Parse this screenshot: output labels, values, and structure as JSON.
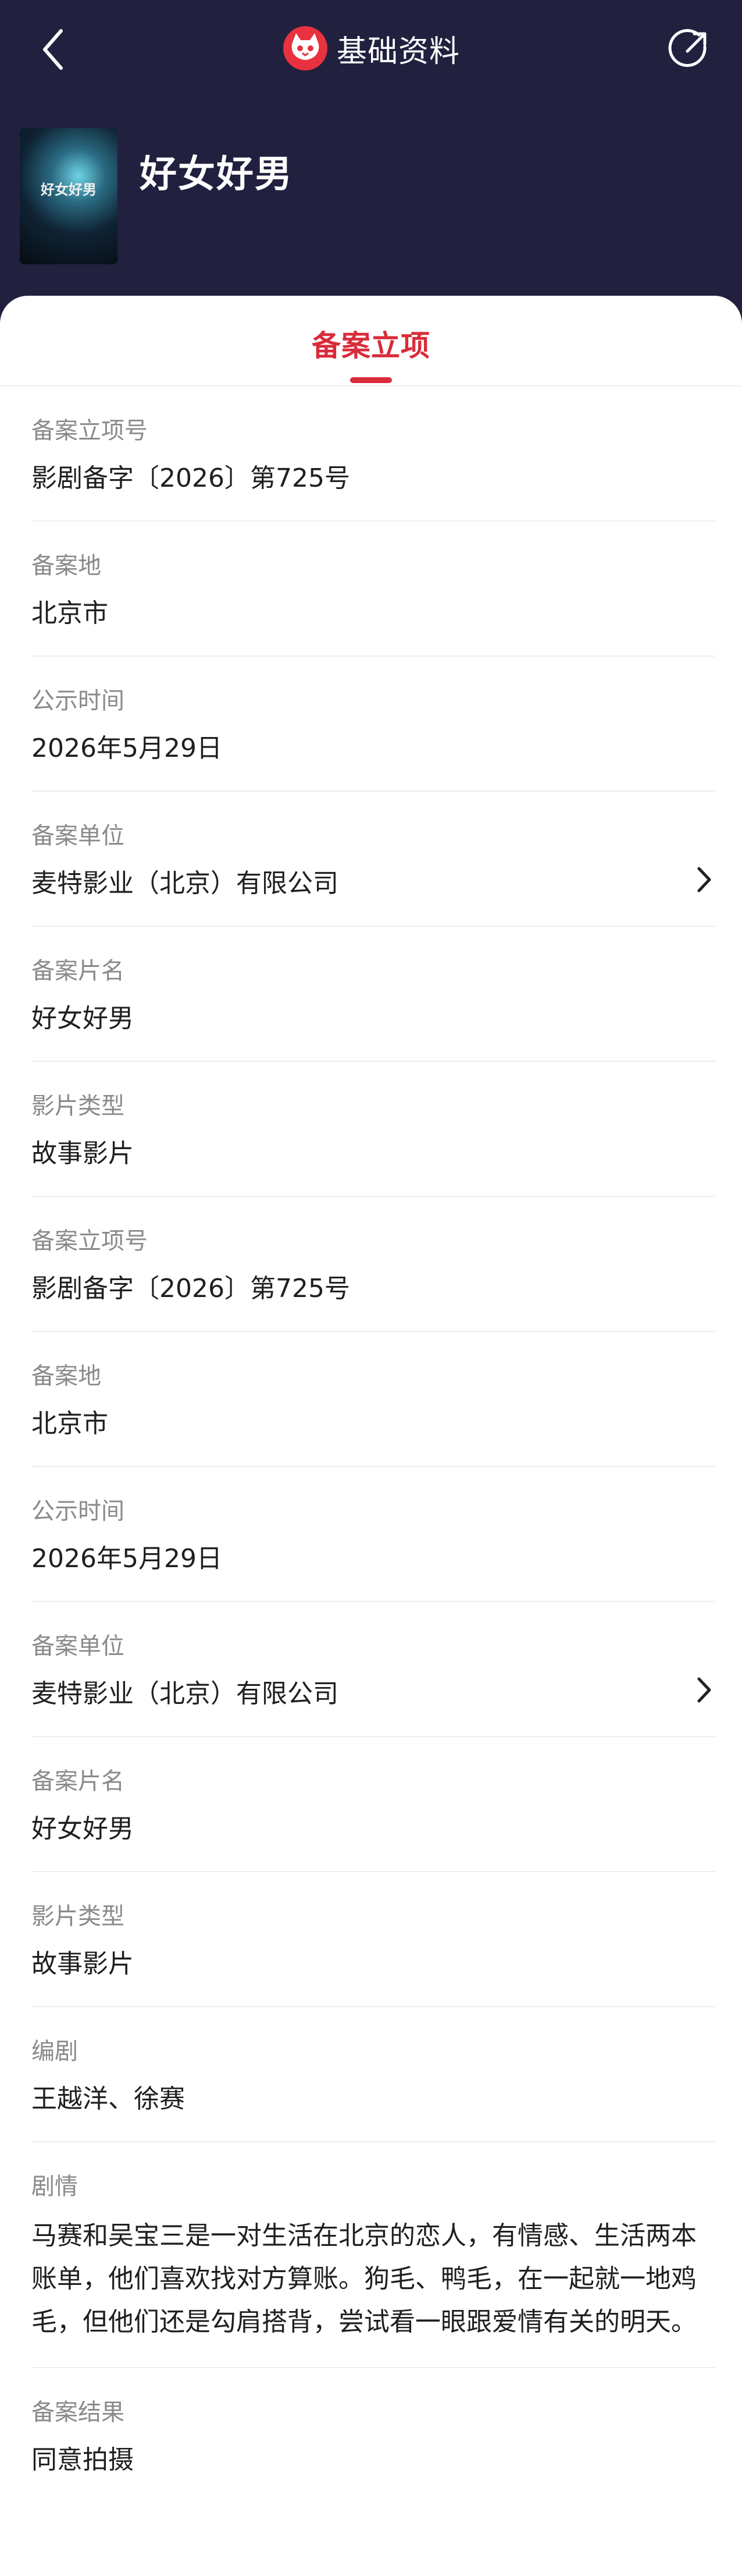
{
  "nav": {
    "title": "基础资料",
    "back_icon": "chevron-left-icon",
    "share_icon": "share-icon",
    "logo_icon": "maoyan-cat-logo"
  },
  "movie": {
    "title": "好女好男",
    "poster_text": "好女好男"
  },
  "tab": {
    "active_label": "备案立项",
    "accent": "#d92b3a"
  },
  "rows": [
    {
      "label": "备案立项号",
      "value": "影剧备字〔2026〕第725号",
      "arrow": false
    },
    {
      "label": "备案地",
      "value": "北京市",
      "arrow": false
    },
    {
      "label": "公示时间",
      "value": "2026年5月29日",
      "arrow": false
    },
    {
      "label": "备案单位",
      "value": "麦特影业（北京）有限公司",
      "arrow": true
    },
    {
      "label": "备案片名",
      "value": "好女好男",
      "arrow": false
    },
    {
      "label": "影片类型",
      "value": "故事影片",
      "arrow": false
    },
    {
      "label": "备案立项号",
      "value": "影剧备字〔2026〕第725号",
      "arrow": false
    },
    {
      "label": "备案地",
      "value": "北京市",
      "arrow": false
    },
    {
      "label": "公示时间",
      "value": "2026年5月29日",
      "arrow": false
    },
    {
      "label": "备案单位",
      "value": "麦特影业（北京）有限公司",
      "arrow": true
    },
    {
      "label": "备案片名",
      "value": "好女好男",
      "arrow": false
    },
    {
      "label": "影片类型",
      "value": "故事影片",
      "arrow": false
    },
    {
      "label": "编剧",
      "value": "王越洋、徐赛",
      "arrow": false
    },
    {
      "label": "剧情",
      "value": "马赛和吴宝三是一对生活在北京的恋人，有情感、生活两本账单，他们喜欢找对方算账。狗毛、鸭毛，在一起就一地鸡毛，但他们还是勾肩搭背，尝试看一眼跟爱情有关的明天。",
      "arrow": false
    },
    {
      "label": "备案结果",
      "value": "同意拍摄",
      "arrow": false
    }
  ],
  "colors": {
    "header_bg": "#22203f",
    "label": "#8a8a8a",
    "value": "#1f1f1f",
    "divider": "#eeeeee"
  }
}
